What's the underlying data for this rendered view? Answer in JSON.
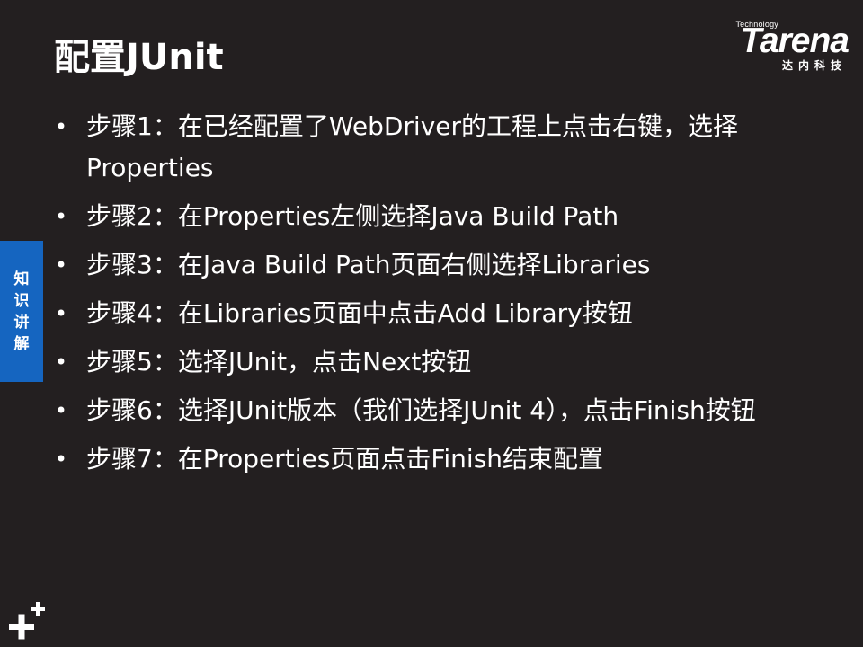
{
  "slide": {
    "title": "配置JUnit",
    "side_tab": [
      "知",
      "识",
      "讲",
      "解"
    ],
    "bullet_char": "•",
    "steps": [
      "步骤1：在已经配置了WebDriver的工程上点击右键，选择Properties",
      "步骤2：在Properties左侧选择Java Build Path",
      "步骤3：在Java Build Path页面右侧选择Libraries",
      "步骤4：在Libraries页面中点击Add Library按钮",
      "步骤5：选择JUnit，点击Next按钮",
      "步骤6：选择JUnit版本（我们选择JUnit 4），点击Finish按钮",
      "步骤7：在Properties页面点击Finish结束配置"
    ]
  },
  "logo": {
    "small": "Technology",
    "word": "Tarena",
    "cn": "达内科技"
  },
  "colors": {
    "background": "#231f20",
    "side_tab": "#1565c0",
    "text": "#ffffff"
  },
  "icons": {
    "corner": "plus-plus-icon"
  }
}
